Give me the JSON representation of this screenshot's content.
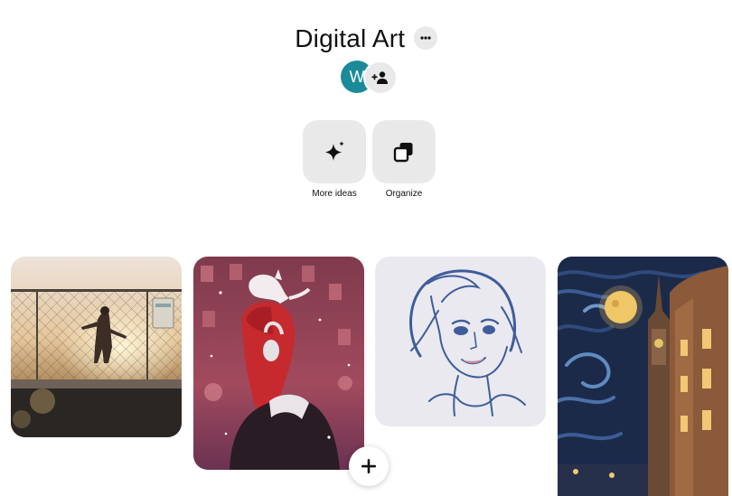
{
  "board": {
    "title": "Digital Art",
    "more_icon": "ellipsis-icon"
  },
  "collaborators": {
    "owner_initial": "W",
    "owner_color": "#1a8a99",
    "add_icon": "add-person-icon"
  },
  "actions": [
    {
      "label": "More ideas",
      "icon": "sparkle-icon"
    },
    {
      "label": "Organize",
      "icon": "organize-icon"
    }
  ],
  "pins": [
    {
      "subject": "girl on rooftop behind chain-link fence at sunset",
      "icon": "pin-image"
    },
    {
      "subject": "red-haired girl with headphones and white cat in snow",
      "icon": "pin-image"
    },
    {
      "subject": "blue sketch portrait of smiling girl with bob hair",
      "icon": "pin-image"
    },
    {
      "subject": "starry night style painting of city tower and moon",
      "icon": "pin-image"
    }
  ],
  "fab": {
    "icon": "plus-icon"
  },
  "colors": {
    "chip_background": "#e9e9e9",
    "text": "#111111"
  }
}
